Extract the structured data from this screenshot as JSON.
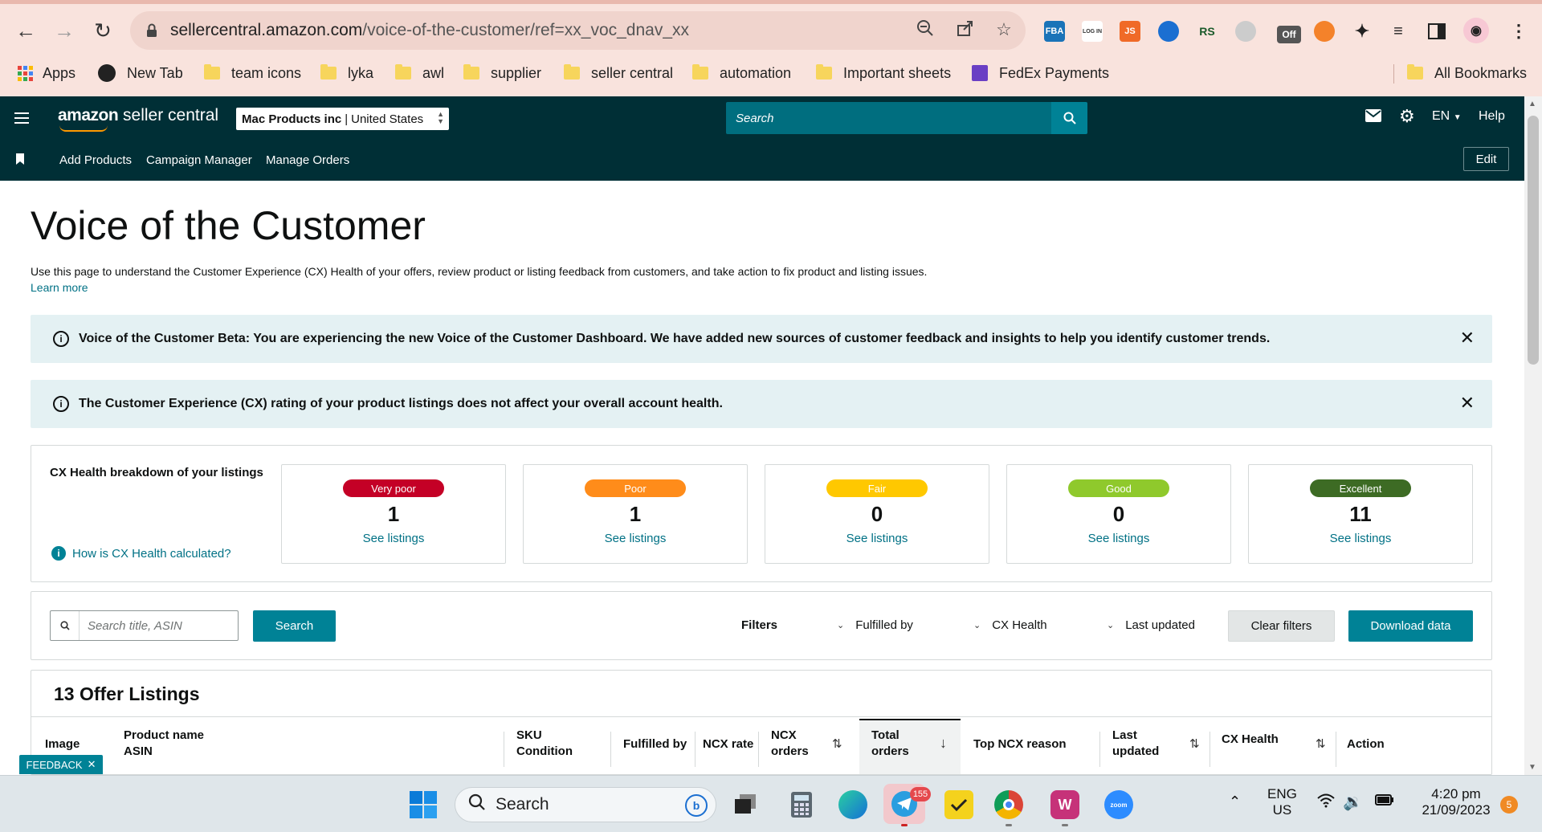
{
  "browser": {
    "url_host": "sellercentral.amazon.com",
    "url_path": "/voice-of-the-customer/ref=xx_voc_dnav_xx",
    "extensions": [
      "FBA",
      "LOG IN",
      "JS",
      "ext-blue",
      "RS",
      "ext-gray",
      "Off",
      "ext-orange"
    ],
    "bookmarks": [
      "Apps",
      "New Tab",
      "team icons",
      "lyka",
      "awl",
      "supplier",
      "seller central",
      "automation",
      "Important sheets",
      "FedEx Payments"
    ],
    "all_bookmarks": "All Bookmarks"
  },
  "header": {
    "logo_main": "amazon",
    "logo_sub": "seller central",
    "account_name": "Mac Products inc",
    "account_region": "United States",
    "search_placeholder": "Search",
    "language": "EN",
    "help": "Help",
    "nav": [
      "Add Products",
      "Campaign Manager",
      "Manage Orders"
    ],
    "edit": "Edit"
  },
  "page": {
    "title": "Voice of the Customer",
    "description": "Use this page to understand the Customer Experience (CX) Health of your offers, review product or listing feedback from customers, and take action to fix product and listing issues.",
    "learn_more": "Learn more",
    "alerts": [
      "Voice of the Customer Beta: You are experiencing the new Voice of the Customer Dashboard. We have added new sources of customer feedback and insights to help you identify customer trends.",
      "The Customer Experience (CX) rating of your product listings does not affect your overall account health."
    ]
  },
  "cx_health": {
    "title": "CX Health breakdown of your listings",
    "how_link": "How is CX Health calculated?",
    "cards": [
      {
        "label": "Very poor",
        "count": "1",
        "link": "See listings",
        "color": "#c40026"
      },
      {
        "label": "Poor",
        "count": "1",
        "link": "See listings",
        "color": "#ff8c1a"
      },
      {
        "label": "Fair",
        "count": "0",
        "link": "See listings",
        "color": "#ffc800"
      },
      {
        "label": "Good",
        "count": "0",
        "link": "See listings",
        "color": "#8fc92c"
      },
      {
        "label": "Excellent",
        "count": "11",
        "link": "See listings",
        "color": "#3d6b24"
      }
    ]
  },
  "filters": {
    "search_placeholder": "Search title, ASIN",
    "search_button": "Search",
    "label": "Filters",
    "dropdowns": [
      "Fulfilled by",
      "CX Health",
      "Last updated"
    ],
    "clear": "Clear filters",
    "download": "Download data"
  },
  "listings": {
    "title": "13 Offer Listings",
    "columns": {
      "image": "Image",
      "product_name": "Product name",
      "asin": "ASIN",
      "sku": "SKU",
      "condition": "Condition",
      "fulfilled_by": "Fulfilled by",
      "ncx_rate": "NCX rate",
      "ncx": "NCX",
      "orders": "orders",
      "total": "Total",
      "top_ncx_reason": "Top NCX reason",
      "last": "Last",
      "updated": "updated",
      "cx_health": "CX Health",
      "action": "Action"
    }
  },
  "feedback_tab": "FEEDBACK",
  "taskbar": {
    "search": "Search",
    "telegram_badge": "155",
    "lang_top": "ENG",
    "lang_bottom": "US",
    "time": "4:20 pm",
    "date": "21/09/2023",
    "notification_count": "5"
  }
}
